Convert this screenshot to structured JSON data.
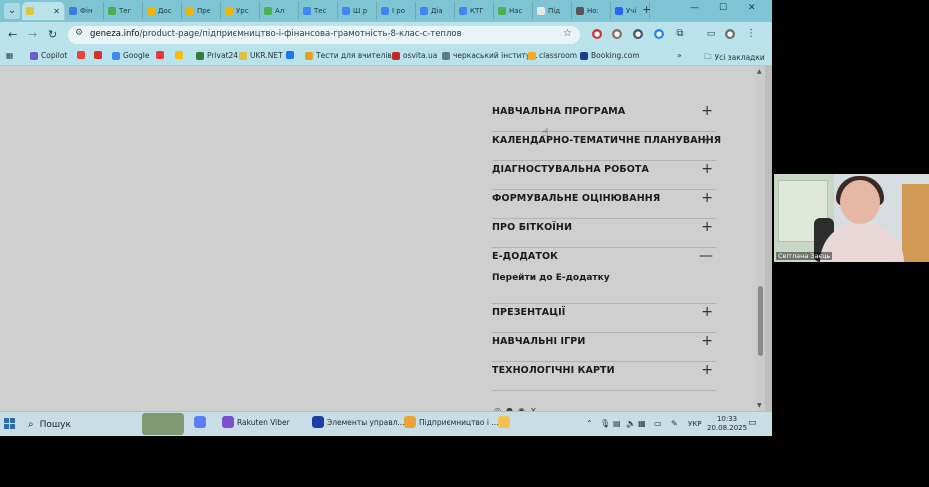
{
  "browser": {
    "tabs": [
      {
        "label": "Фін",
        "color": "#3d7de0"
      },
      {
        "label": "Тег",
        "color": "#4caf50"
      },
      {
        "label": "Дос",
        "color": "#f4b400"
      },
      {
        "label": "Прє",
        "color": "#f4b400"
      },
      {
        "label": "Урс",
        "color": "#f4b400"
      },
      {
        "label": "Ал",
        "color": "#4caf50"
      },
      {
        "label": "Тес",
        "color": "#4285f4"
      },
      {
        "label": "Ш р",
        "color": "#4285f4"
      },
      {
        "label": "І ро",
        "color": "#4285f4"
      },
      {
        "label": "Діа",
        "color": "#4285f4"
      },
      {
        "label": "КТГ",
        "color": "#4285f4"
      },
      {
        "label": "Нас",
        "color": "#4caf50"
      },
      {
        "label": "Під",
        "color": "#e8e8e8"
      },
      {
        "label": "Но:",
        "color": "#555555"
      },
      {
        "label": "Учі",
        "color": "#2962ff"
      }
    ],
    "url_host": "geneza.info",
    "url_path": "/product-page/підприємництво-і-фінансова-грамотність-8-клас-с-теплов",
    "bookmarks": [
      {
        "label": "Copilot",
        "color": "#6a5acd"
      },
      {
        "label": "Google",
        "color": "#4285f4"
      },
      {
        "label": "Privat24",
        "color": "#2e7d32"
      },
      {
        "label": "UKR.NET",
        "color": "#e0c040"
      },
      {
        "label": "Тести для вчителів...",
        "color": "#e0a020"
      },
      {
        "label": "osvita.ua",
        "color": "#c62828"
      },
      {
        "label": "черкаський інститу...",
        "color": "#607d8b"
      },
      {
        "label": "classroom",
        "color": "#f9a825"
      },
      {
        "label": "Booking.com",
        "color": "#1a3c8b"
      }
    ],
    "bookmarks_folder": "Усі закладки"
  },
  "accordion": [
    {
      "title": "НАВЧАЛЬНА ПРОГРАМА",
      "sign": "+"
    },
    {
      "title": "КАЛЕНДАРНО-ТЕМАТИЧНЕ ПЛАНУВАННЯ",
      "sign": "+"
    },
    {
      "title": "ДІАГНОСТУВАЛЬНА РОБОТА",
      "sign": "+"
    },
    {
      "title": "ФОРМУВАЛЬНЕ ОЦІНЮВАННЯ",
      "sign": "+"
    },
    {
      "title": "ПРО БІТКОЇНИ",
      "sign": "+"
    },
    {
      "title": "Е-ДОДАТОК",
      "sign": "—",
      "link": "Перейти до Е-додатку"
    },
    {
      "title": "ПРЕЗЕНТАЦІЇ",
      "sign": "+"
    },
    {
      "title": "НАВЧАЛЬНІ ІГРИ",
      "sign": "+"
    },
    {
      "title": "ТЕХНОЛОГІЧНІ КАРТИ",
      "sign": "+"
    }
  ],
  "taskbar": {
    "search_label": "Пошук",
    "apps": [
      {
        "label": "Rakuten Viber",
        "color": "#7b4fd0"
      },
      {
        "label": "Элементы управл...",
        "color": "#1e3fa8"
      },
      {
        "label": "Підприємництво і ...",
        "color": "#e8a33a"
      }
    ],
    "lang": "УКР",
    "time": "10:33",
    "date": "20.08.2025"
  },
  "video": {
    "participant_name": "Світлана Заєць"
  }
}
